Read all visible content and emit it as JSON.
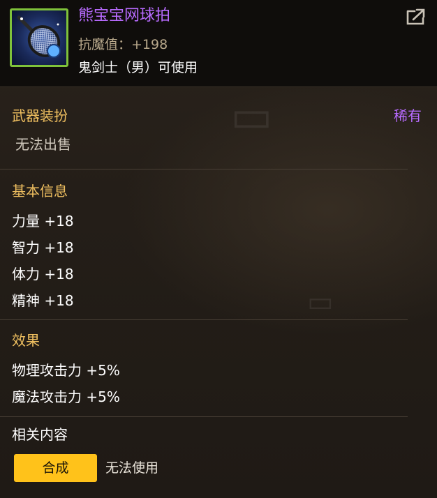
{
  "item": {
    "name": "熊宝宝网球拍",
    "stat_line": "抗魔值：+198",
    "usable_by": "鬼剑士（男）可使用",
    "rarity": "稀有",
    "colors": {
      "name": "#b86bff",
      "rarity": "#b86bff",
      "icon_border": "#7fc23a",
      "section_title": "#f0c060"
    }
  },
  "header": {
    "share_icon": "share-export-icon"
  },
  "category": {
    "title": "武器装扮",
    "sell_status": "无法出售"
  },
  "basic_info": {
    "title": "基本信息",
    "stats": [
      "力量 +18",
      "智力 +18",
      "体力 +18",
      "精神 +18"
    ]
  },
  "effects": {
    "title": "效果",
    "items": [
      "物理攻击力 +5%",
      "魔法攻击力 +5%"
    ]
  },
  "related": {
    "title": "相关内容",
    "synthesize_label": "合成",
    "status": "无法使用",
    "button_color": "#ffc21a"
  }
}
